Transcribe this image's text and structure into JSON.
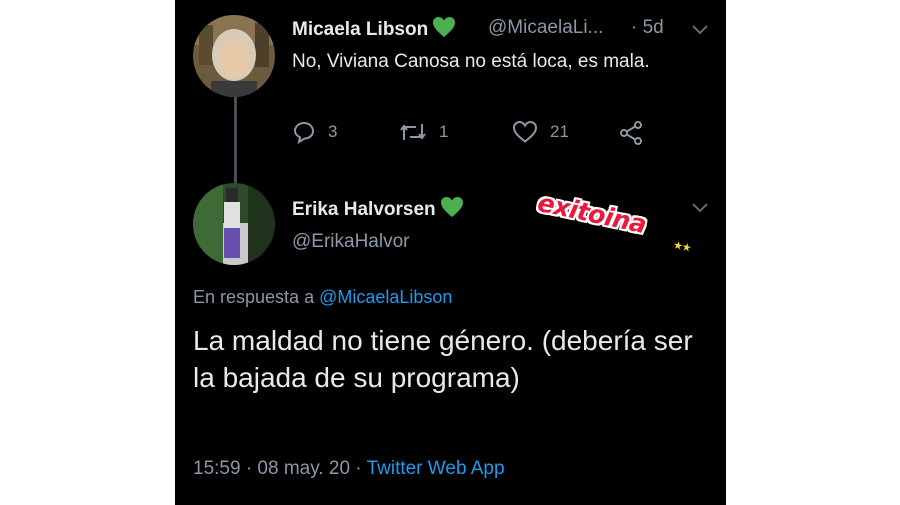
{
  "tweet1": {
    "name": "Micaela Libson",
    "handle": "@MicaelaLi...",
    "time": "· 5d",
    "text": "No, Viviana Canosa no está loca, es mala.",
    "replies": "3",
    "retweets": "1",
    "likes": "21"
  },
  "tweet2": {
    "name": "Erika Halvorsen",
    "handle": "@ErikaHalvor",
    "reply_prefix": "En respuesta a",
    "reply_mention": "@MicaelaLibson",
    "text": "La maldad no tiene género. (debería ser la bajada de su programa)",
    "time": "15:59 · 08 may. 20 ·",
    "source": "Twitter Web App"
  },
  "sticker": {
    "text": "exitoina",
    "stars": "★★"
  },
  "colors": {
    "background": "#000000",
    "text": "#e7e9ea",
    "secondary": "#8b98a5",
    "link": "#1d9bf0",
    "heart": "#4caf50",
    "sticker": "#e8193c"
  }
}
